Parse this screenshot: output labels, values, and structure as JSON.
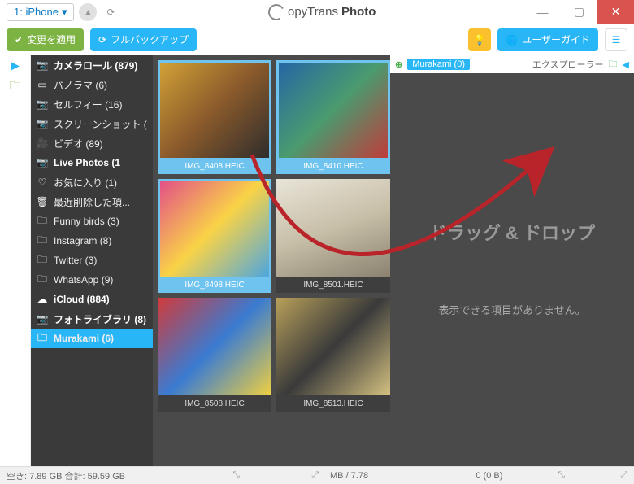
{
  "titlebar": {
    "device": "1: iPhone",
    "app_name_1": "opyTrans",
    "app_name_2": "Photo"
  },
  "toolbar": {
    "apply": "変更を適用",
    "backup": "フルバックアップ",
    "user_guide": "ユーザーガイド"
  },
  "sidebar": {
    "items": [
      {
        "icon": "camera",
        "label": "カメラロール (879)",
        "bold": true
      },
      {
        "icon": "pano",
        "label": "パノラマ (6)"
      },
      {
        "icon": "camera",
        "label": "セルフィー (16)"
      },
      {
        "icon": "camera",
        "label": "スクリーンショット ("
      },
      {
        "icon": "video",
        "label": "ビデオ (89)"
      },
      {
        "icon": "camera",
        "label": "Live Photos (1",
        "bold": true
      },
      {
        "icon": "heart",
        "label": "お気に入り (1)"
      },
      {
        "icon": "trash",
        "label": "最近削除した項..."
      },
      {
        "icon": "folder",
        "label": "Funny birds (3)"
      },
      {
        "icon": "folder",
        "label": "Instagram (8)"
      },
      {
        "icon": "folder",
        "label": "Twitter (3)"
      },
      {
        "icon": "folder",
        "label": "WhatsApp (9)"
      },
      {
        "icon": "cloud",
        "label": "iCloud (884)",
        "bold": true
      },
      {
        "icon": "camera",
        "label": "フォトライブラリ (8)",
        "bold": true
      },
      {
        "icon": "folder",
        "label": "Murakami (6)",
        "active": true
      }
    ]
  },
  "photos": [
    {
      "name": "IMG_8408.HEIC",
      "sel": true
    },
    {
      "name": "IMG_8410.HEIC",
      "sel": true
    },
    {
      "name": "IMG_8498.HEIC",
      "sel": true
    },
    {
      "name": "IMG_8501.HEIC"
    },
    {
      "name": "IMG_8508.HEIC"
    },
    {
      "name": "IMG_8513.HEIC"
    }
  ],
  "drop": {
    "header_tag": "Murakami (0)",
    "header_right": "エクスプローラー",
    "title": "ドラッグ & ドロップ",
    "message": "表示できる項目がありません。"
  },
  "status": {
    "left": "空き: 7.89 GB 合計: 59.59 GB",
    "mid": "MB / 7.78",
    "right": "0 (0 B)"
  },
  "icons": {
    "camera": "📷",
    "pano": "▭",
    "video": "🎥",
    "heart": "♡",
    "trash": "🗑",
    "folder": "🗀",
    "cloud": "☁"
  }
}
